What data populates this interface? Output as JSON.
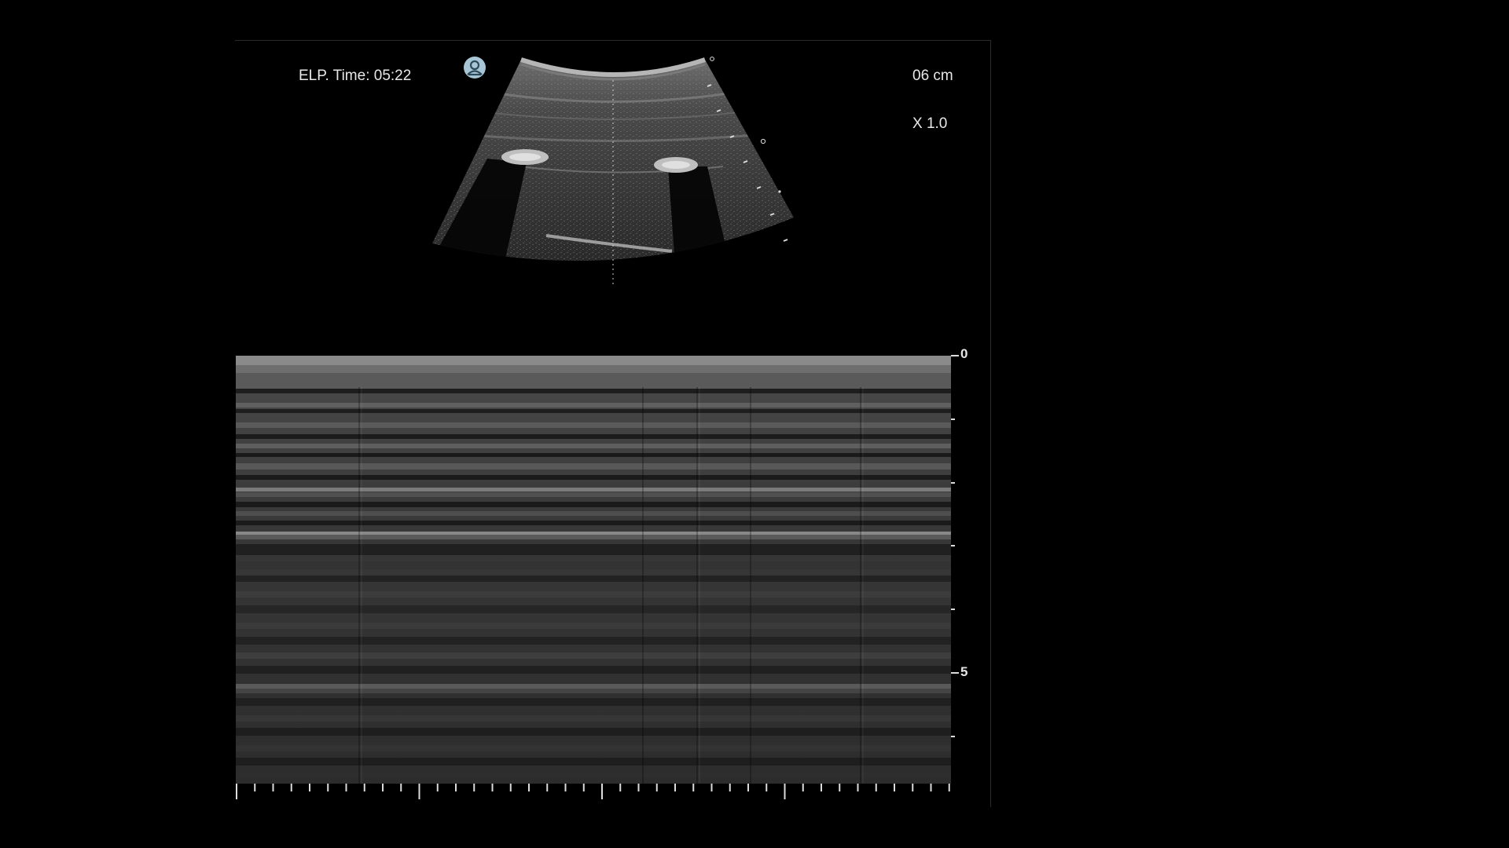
{
  "overlay": {
    "elapsed_time": "ELP. Time: 05:22",
    "depth": "06 cm",
    "zoom": "X 1.0"
  },
  "depth_scale": {
    "zero_label": "0",
    "five_label": "5"
  },
  "icons": {
    "patient": "patient-user-icon"
  },
  "colors": {
    "background": "#000000",
    "patient_icon": "#a9c6d6",
    "text": "#e8e8e8"
  }
}
